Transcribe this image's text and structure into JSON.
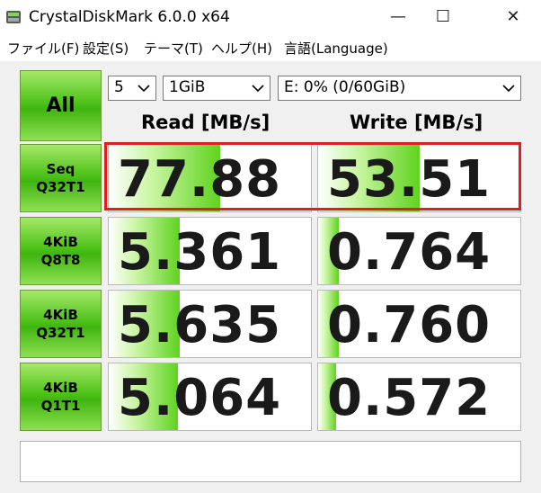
{
  "window": {
    "title": "CrystalDiskMark 6.0.0 x64",
    "controls": {
      "minimize": "—",
      "maximize": "☐",
      "close": "✕"
    }
  },
  "menu": {
    "items": [
      "ファイル(F)",
      "設定(S)",
      "テーマ(T)",
      "ヘルプ(H)",
      "言語(Language)"
    ]
  },
  "toolbar": {
    "all_label": "All",
    "count": "5",
    "size": "1GiB",
    "drive": "E: 0% (0/60GiB)"
  },
  "headers": {
    "read": "Read [MB/s]",
    "write": "Write [MB/s]"
  },
  "tests": [
    {
      "line1": "Seq",
      "line2": "Q32T1",
      "read": "77.88",
      "write": "53.51",
      "read_fill": 0.55,
      "write_fill": 0.5
    },
    {
      "line1": "4KiB",
      "line2": "Q8T8",
      "read": "5.361",
      "write": "0.764",
      "read_fill": 0.35,
      "write_fill": 0.1
    },
    {
      "line1": "4KiB",
      "line2": "Q32T1",
      "read": "5.635",
      "write": "0.760",
      "read_fill": 0.35,
      "write_fill": 0.1
    },
    {
      "line1": "4KiB",
      "line2": "Q1T1",
      "read": "5.064",
      "write": "0.572",
      "read_fill": 0.34,
      "write_fill": 0.09
    }
  ],
  "comment": "",
  "colors": {
    "accent_green": "#4fc31a",
    "highlight_red": "#e01e1e"
  }
}
